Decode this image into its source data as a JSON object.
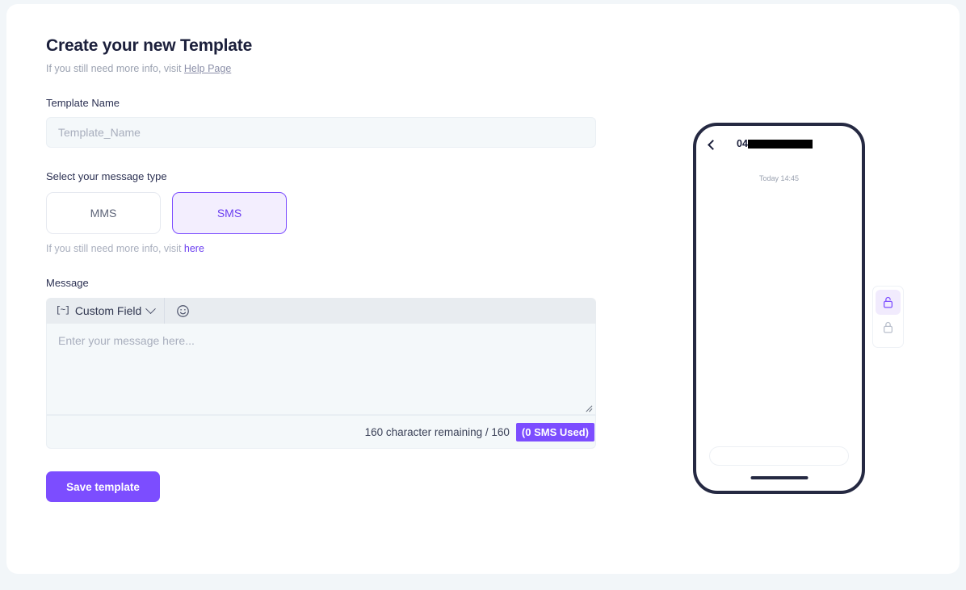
{
  "header": {
    "title": "Create your new Template",
    "subtitle_prefix": "If you still need more info, visit ",
    "subtitle_link": "Help Page"
  },
  "template_name": {
    "label": "Template Name",
    "value": "",
    "placeholder": "Template_Name"
  },
  "message_type": {
    "label": "Select your message type",
    "options": [
      {
        "label": "MMS",
        "active": false
      },
      {
        "label": "SMS",
        "active": true
      }
    ],
    "hint_prefix": "If you still need more info, visit ",
    "hint_link": "here"
  },
  "message": {
    "label": "Message",
    "toolbar": {
      "custom_field_bracket": "[~]",
      "custom_field_label": "Custom Field",
      "emoji_icon": "smiley-icon"
    },
    "value": "",
    "placeholder": "Enter your message here...",
    "counter_text": "160 character remaining / 160",
    "sms_badge": "(0 SMS Used)"
  },
  "actions": {
    "save_label": "Save template"
  },
  "preview": {
    "back_icon": "chevron-left-icon",
    "contact_prefix": "04",
    "contact_redacted": true,
    "timestamp": "Today 14:45",
    "input_placeholder": ""
  },
  "lock_widget": {
    "items": [
      {
        "icon": "unlock-icon",
        "active": true
      },
      {
        "icon": "lock-icon",
        "active": false
      }
    ]
  },
  "colors": {
    "accent": "#7c4dff",
    "accent_soft": "#f3eefe",
    "page_bg": "#f2f6f9",
    "field_bg": "#f4f8fa",
    "toolbar_bg": "#e8ecf0",
    "ink": "#1b1f3b"
  }
}
